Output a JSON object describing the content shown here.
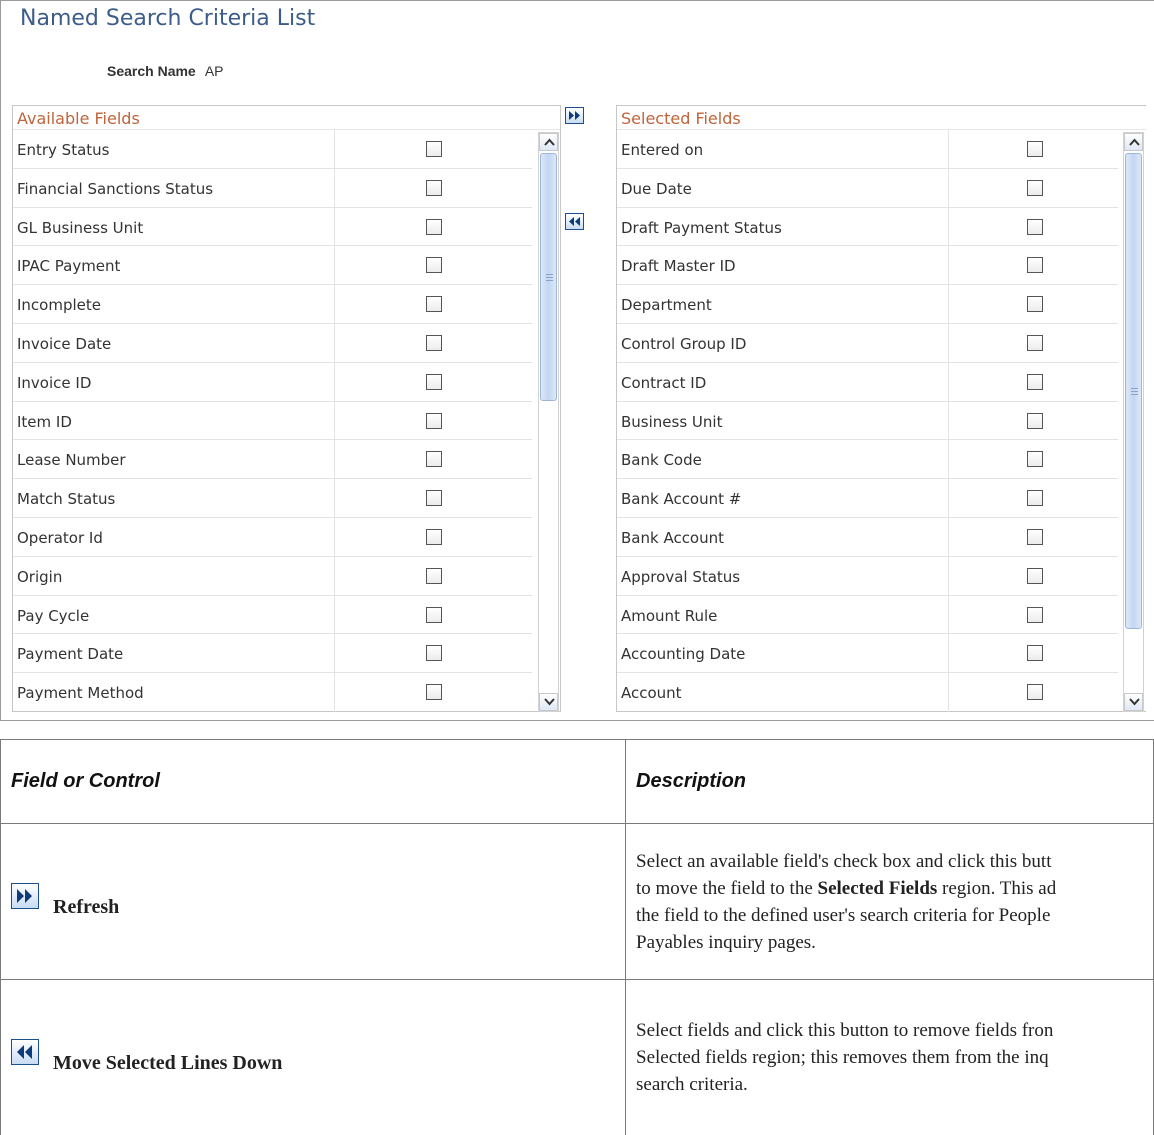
{
  "page": {
    "title": "Named Search Criteria List",
    "search_name_label": "Search Name",
    "search_name_value": "AP"
  },
  "available": {
    "header": "Available Fields",
    "items": [
      "Entry Status",
      "Financial Sanctions Status",
      "GL Business Unit",
      "IPAC Payment",
      "Incomplete",
      "Invoice Date",
      "Invoice ID",
      "Item ID",
      "Lease Number",
      "Match Status",
      "Operator Id",
      "Origin",
      "Pay Cycle",
      "Payment Date",
      "Payment Method"
    ]
  },
  "selected": {
    "header": "Selected Fields",
    "items": [
      "Entered on",
      "Due Date",
      "Draft Payment Status",
      "Draft Master ID",
      "Department",
      "Control Group ID",
      "Contract ID",
      "Business Unit",
      "Bank Code",
      "Bank Account #",
      "Bank Account",
      "Approval Status",
      "Amount Rule",
      "Accounting Date",
      "Account"
    ]
  },
  "doc_table": {
    "col_control": "Field or Control",
    "col_description": "Description",
    "rows": [
      {
        "label": "Refresh",
        "icon": "double-right-arrow-icon",
        "desc_parts": [
          "Select an available field's check box and click this butt",
          "to move the field to the ",
          "Selected Fields",
          " region. This ad",
          "the field to the defined user's search criteria for People",
          "Payables inquiry pages."
        ]
      },
      {
        "label": "Move Selected Lines Down",
        "icon": "double-left-arrow-icon",
        "desc_lines": [
          "Select fields and click this button to remove fields fron",
          "Selected fields region; this removes them from the inq",
          "search criteria."
        ]
      }
    ]
  }
}
